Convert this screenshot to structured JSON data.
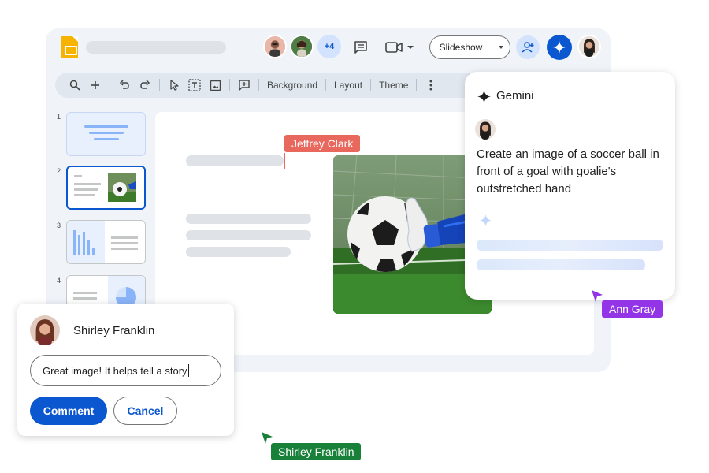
{
  "app": {
    "name": "Google Slides"
  },
  "header": {
    "collaborator_overflow": "+4",
    "slideshow_label": "Slideshow"
  },
  "toolbar": {
    "background_label": "Background",
    "layout_label": "Layout",
    "theme_label": "Theme"
  },
  "filmstrip": {
    "slides": [
      {
        "number": "1"
      },
      {
        "number": "2"
      },
      {
        "number": "3"
      },
      {
        "number": "4"
      }
    ]
  },
  "cursors": {
    "jeffrey": {
      "name": "Jeffrey Clark",
      "color": "#e8685d"
    },
    "ann": {
      "name": "Ann Gray",
      "color": "#9334e6"
    },
    "shirley": {
      "name": "Shirley Franklin",
      "color": "#188038"
    }
  },
  "gemini": {
    "title": "Gemini",
    "prompt": "Create an image of a soccer ball in front of a goal with goalie's outstretched hand"
  },
  "comment": {
    "author": "Shirley Franklin",
    "text": "Great image! It helps tell a story",
    "submit_label": "Comment",
    "cancel_label": "Cancel"
  },
  "colors": {
    "accent": "#0b57d0",
    "window_bg": "#f0f4f9",
    "slides_yellow": "#f6b400"
  }
}
